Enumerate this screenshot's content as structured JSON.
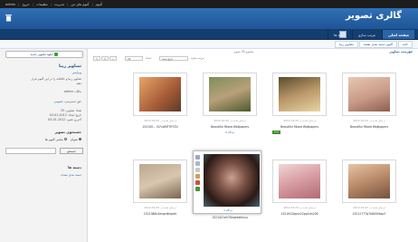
{
  "topbar": {
    "items": [
      "admin",
      "خروج",
      "تنظیمات",
      "مدیریت",
      "آلبوم های من",
      "آلبوم"
    ]
  },
  "header": {
    "title": "گالری تصویر"
  },
  "nav": {
    "tabs": [
      "صفحه اصلی",
      "مرتب سازی",
      "دسته ها"
    ]
  },
  "subnav": {
    "tabs": [
      "خانه",
      "آلبوم دسته بندی نشده",
      "تصاویر زیبا"
    ]
  },
  "sidebar": {
    "add_button": "آپلود تصویر جدید",
    "album_title": "تصاویر زیبا",
    "album_link": "ویرایش",
    "desc_line1": "تصاویر زیبا و خلاقانه را در این آلبوم قرار",
    "desc_line2": "دهید",
    "owner_line": "مالک: admin",
    "rights_label": "حق دسترسی:",
    "rights_value": "عمومی",
    "stats_1": "تعداد تصاویر: 35",
    "stats_2": "تاریخ ایجاد: 2012-01-03",
    "stats_3": "آخرین تغییر: 2012-01-03",
    "sort_title": "جستجوی تصویر",
    "radio_1": "عنوان",
    "radio_2": "تمامی آلبوم ها",
    "search_button": "جستجو",
    "category_title": "دسته ها",
    "category_link": "دسته بندی نشده"
  },
  "toolbar": {
    "breadcrumb": "فهرست تصاویر",
    "count": "مجموع 35 تصویر",
    "sort_label": "مرتب سازی:",
    "sort_value": "تاریخ ایجاد",
    "per_page_label": "تعداد:",
    "per_page_value": "21",
    "pages": [
      "1",
      "2",
      "»"
    ]
  },
  "photos": [
    {
      "date": "2012-01-02 ارسال شده در",
      "caption": "152150... IS7czfNF7ff7ZV",
      "count": "",
      "badge": ""
    },
    {
      "date": "2012-01-02 ارسال شده در",
      "caption": "Beautiful Mixed Wallpapers",
      "count": "2 دیدگاه",
      "badge": ""
    },
    {
      "date": "2012-01-02 ارسال شده در",
      "caption": "Beautiful Mixed Wallpapers",
      "count": "",
      "badge": "جدید"
    },
    {
      "date": "2012-01-02 ارسال شده در",
      "caption": "Beautiful Mixed Wallpapers",
      "count": "",
      "badge": ""
    },
    {
      "date": "2012-01-02 ارسال شده در",
      "caption": "1521388u2euqrdklqzkk",
      "count": "",
      "badge": ""
    },
    {
      "date": "",
      "caption": "1521421eh7Xkpeeeklxuu",
      "count": "",
      "badge": ""
    },
    {
      "date": "2012-01-02 ارسال شده در",
      "caption": "1521612dpvv22pp1dn226",
      "count": "",
      "badge": ""
    },
    {
      "date": "2012-01-02 ارسال شده در",
      "caption": "1521277Tq7k8000bxp7",
      "count": "",
      "badge": ""
    }
  ],
  "popup": {
    "count": "1 دیدگاه"
  }
}
